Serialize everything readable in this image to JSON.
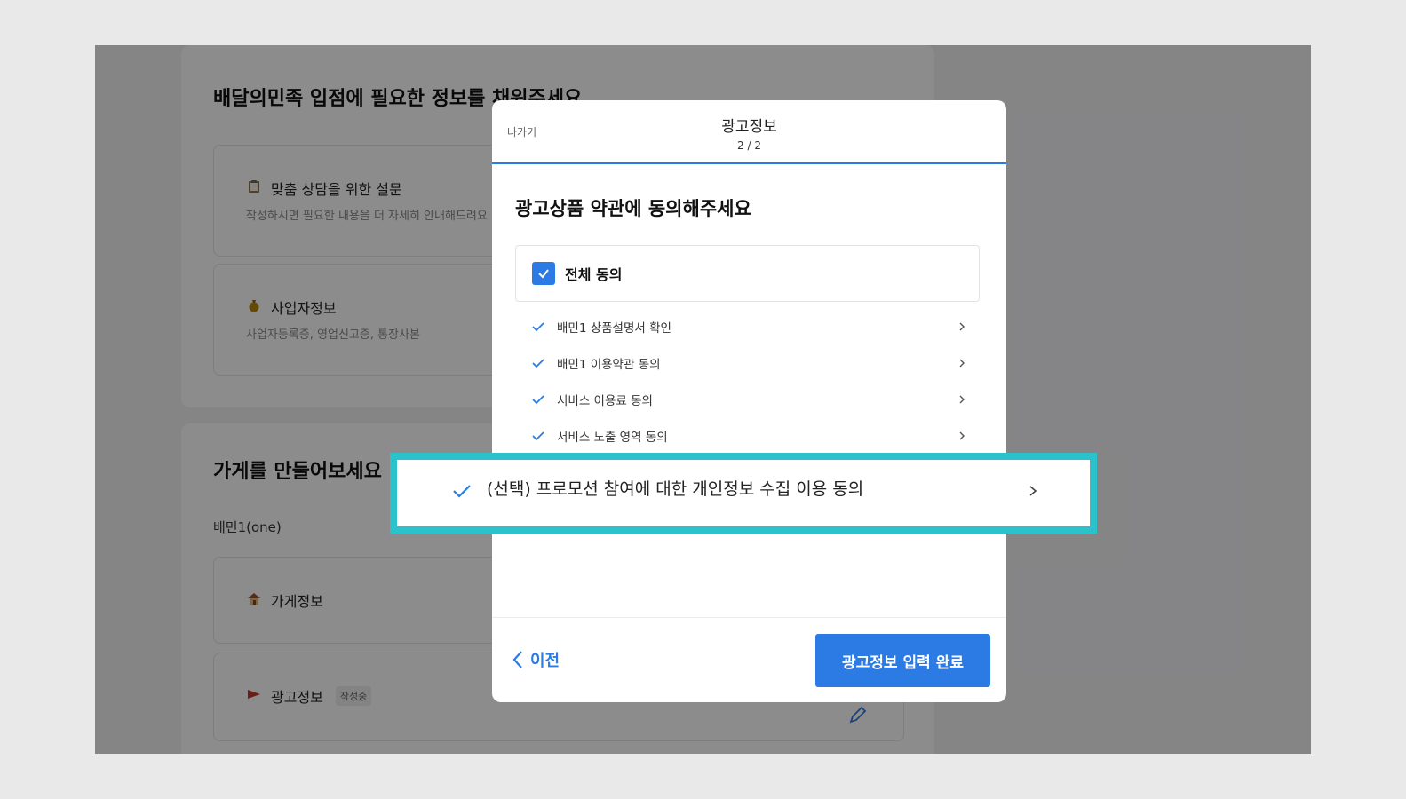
{
  "background": {
    "section1_title": "배달의민족 입점에 필요한 정보를 채워주세요",
    "survey": {
      "title": "맞춤 상담을 위한 설문",
      "desc": "작성하시면 필요한 내용을 더 자세히 안내해드려요",
      "icon": "clipboard-icon"
    },
    "business": {
      "title": "사업자정보",
      "desc": "사업자등록증, 영업신고증, 통장사본",
      "icon": "money-bag-icon"
    },
    "section2_title": "가게를 만들어보세요",
    "plan_label": "배민1(one)",
    "store": {
      "title": "가게정보",
      "icon": "house-icon"
    },
    "ad": {
      "title": "광고정보",
      "badge": "작성중",
      "icon": "flag-icon"
    }
  },
  "modal": {
    "exit_label": "나가기",
    "title": "광고정보",
    "step": "2 / 2",
    "heading": "광고상품 약관에 동의해주세요",
    "agree_all_label": "전체 동의",
    "terms": [
      {
        "label": "배민1 상품설명서 확인",
        "checked": true
      },
      {
        "label": "배민1 이용약관 동의",
        "checked": true
      },
      {
        "label": "서비스 이용료 동의",
        "checked": true
      },
      {
        "label": "서비스 노출 영역 동의",
        "checked": true
      }
    ],
    "highlighted_term": {
      "label": "(선택) 프로모션 참여에 대한 개인정보 수집 이용 동의",
      "checked": true
    },
    "prev_label": "이전",
    "complete_label": "광고정보 입력 완료"
  },
  "colors": {
    "accent": "#2c7be5",
    "highlight_border": "#2bc2cc",
    "overlay": "rgba(0,0,0,0.45)"
  }
}
